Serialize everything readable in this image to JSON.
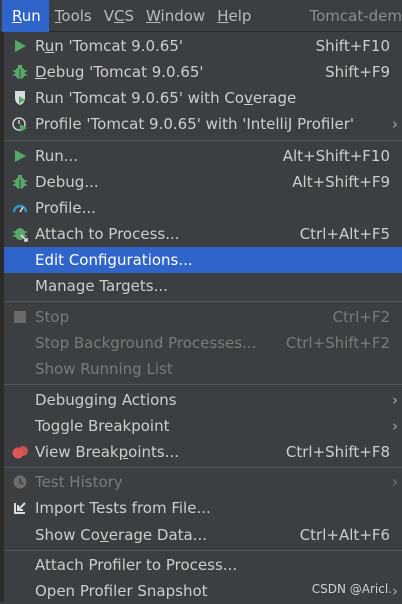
{
  "menubar": {
    "items": [
      {
        "label": "Run",
        "underline_index": 0
      },
      {
        "label": "Tools",
        "underline_index": 0
      },
      {
        "label": "VCS",
        "underline_index": 1
      },
      {
        "label": "Window",
        "underline_index": 0
      },
      {
        "label": "Help",
        "underline_index": 0
      }
    ],
    "project_title": "Tomcat-dem"
  },
  "menu": {
    "run_config": {
      "label_pre": "R",
      "label_u": "u",
      "label_post": "n 'Tomcat 9.0.65'",
      "shortcut": "Shift+F10"
    },
    "debug_config": {
      "label_pre": "",
      "label_u": "D",
      "label_post": "ebug 'Tomcat 9.0.65'",
      "shortcut": "Shift+F9"
    },
    "coverage_config": {
      "label_pre": "Run 'Tomcat 9.0.65' with Co",
      "label_u": "v",
      "label_post": "erage"
    },
    "profile_config": {
      "label": "Profile 'Tomcat 9.0.65' with 'IntelliJ Profiler'",
      "arrow": "›"
    },
    "run_dots": {
      "label": "Run...",
      "shortcut": "Alt+Shift+F10"
    },
    "debug_dots": {
      "label": "Debug...",
      "shortcut": "Alt+Shift+F9"
    },
    "profile_dots": {
      "label": "Profile..."
    },
    "attach": {
      "label": "Attach to Process...",
      "shortcut": "Ctrl+Alt+F5"
    },
    "edit_config": {
      "label": "Edit Configurations..."
    },
    "manage_targets": {
      "label": "Manage Targets..."
    },
    "stop": {
      "label": "Stop",
      "shortcut": "Ctrl+F2"
    },
    "stop_bg": {
      "label": "Stop Background Processes...",
      "shortcut": "Ctrl+Shift+F2"
    },
    "show_running": {
      "label": "Show Running List"
    },
    "debugging_actions": {
      "label": "Debugging Actions",
      "arrow": "›"
    },
    "toggle_breakpoint": {
      "label": "Toggle Breakpoint",
      "arrow": "›"
    },
    "view_breakpoints": {
      "label_pre": "View Break",
      "label_u": "p",
      "label_post": "oints...",
      "shortcut": "Ctrl+Shift+F8"
    },
    "test_history": {
      "label": "Test History",
      "arrow": "›"
    },
    "import_tests": {
      "label": "Import Tests from File..."
    },
    "show_coverage": {
      "label_pre": "Show Co",
      "label_u": "v",
      "label_post": "erage Data...",
      "shortcut": "Ctrl+Alt+F6"
    },
    "attach_profiler": {
      "label": "Attach Profiler to Process..."
    },
    "open_snapshot": {
      "label": "Open Profiler Snapshot",
      "arrow": "›"
    }
  },
  "watermark": "CSDN @Aricl.",
  "colors": {
    "accent": "#2f65ca",
    "run_green": "#59a869",
    "coverage_blue": "#3592c4",
    "breakpoint_red": "#e05555"
  }
}
